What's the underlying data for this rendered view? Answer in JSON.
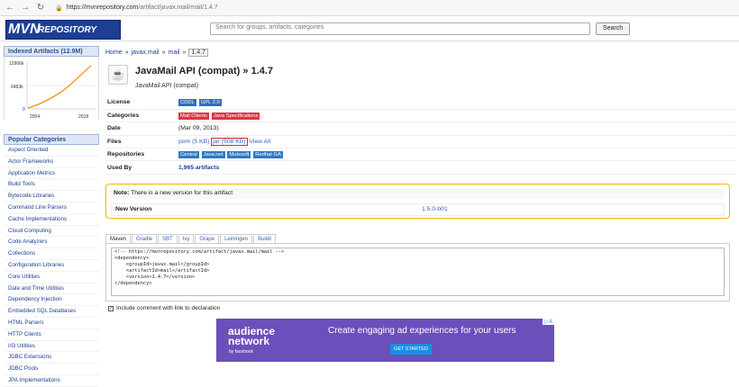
{
  "browser": {
    "back": "←",
    "forward": "→",
    "reload": "↻",
    "url_domain": "https://mvnrepository.com",
    "url_path": "/artifact/javax.mail/mail/1.4.7"
  },
  "header": {
    "logo_text_big": "MVN",
    "logo_text_small": "REPOSITORY",
    "search_placeholder": "Search for groups, artifacts, categories",
    "search_button": "Search"
  },
  "sidebar": {
    "indexed_title": "Indexed Artifacts (12.9M)",
    "chart": {
      "y_ticks": [
        "12966k",
        "6483k",
        "0"
      ],
      "x_ticks": [
        "2004",
        "2018"
      ]
    },
    "popular_title": "Popular Categories",
    "categories": [
      "Aspect Oriented",
      "Actor Frameworks",
      "Application Metrics",
      "Build Tools",
      "Bytecode Libraries",
      "Command Line Parsers",
      "Cache Implementations",
      "Cloud Computing",
      "Code Analyzers",
      "Collections",
      "Configuration Libraries",
      "Core Utilities",
      "Date and Time Utilities",
      "Dependency Injection",
      "Embedded SQL Databases",
      "HTML Parsers",
      "HTTP Clients",
      "I/O Utilities",
      "JDBC Extensions",
      "JDBC Pools",
      "JPA Implementations"
    ]
  },
  "breadcrumb": {
    "home": "Home",
    "separator": "»",
    "group": "javax.mail",
    "artifact": "mail",
    "version": "1.4.7"
  },
  "artifact": {
    "title": "JavaMail API (compat) » 1.4.7",
    "subtitle": "JavaMail API (compat)"
  },
  "details": {
    "license_label": "License",
    "licenses": [
      "CDDL",
      "GPL 2.0"
    ],
    "categories_label": "Categories",
    "categories": [
      "Mail Clients",
      "Java Specifications"
    ],
    "date_label": "Date",
    "date": "(Mar 09, 2013)",
    "files_label": "Files",
    "pom": "pom (5 KB)",
    "jar": "jar (508 KB)",
    "view_all": "View All",
    "repositories_label": "Repositories",
    "repositories": [
      "Central",
      "Java.net",
      "Mulesoft",
      "Redhat GA"
    ],
    "used_by_label": "Used By",
    "used_by": "1,965 artifacts"
  },
  "notice": {
    "note_prefix": "Note:",
    "note_text": " There is a new version for this artifact",
    "new_version_label": "New Version",
    "new_version": "1.5.0-b01"
  },
  "tabs": [
    "Maven",
    "Gradle",
    "SBT",
    "Ivy",
    "Grape",
    "Leiningen",
    "Buildr"
  ],
  "code": {
    "snippet": "<!-- https://mvnrepository.com/artifact/javax.mail/mail -->\n<dependency>\n    <groupId>javax.mail</groupId>\n    <artifactId>mail</artifactId>\n    <version>1.4.7</version>\n</dependency>"
  },
  "declaration": {
    "checkbox_checked": "✓",
    "label": "Include comment with link to declaration"
  },
  "ad": {
    "badge": "▷X",
    "logo_main": "audience\nnetwork",
    "logo_sub": "by facebook",
    "headline": "Create engaging ad experiences for your users",
    "button": "GET STARTED"
  },
  "colors": {
    "accent": "#1c3f94",
    "chart_line": "#f39c12",
    "notice_border": "#f2b700",
    "ad_background": "#6b4fbb"
  }
}
